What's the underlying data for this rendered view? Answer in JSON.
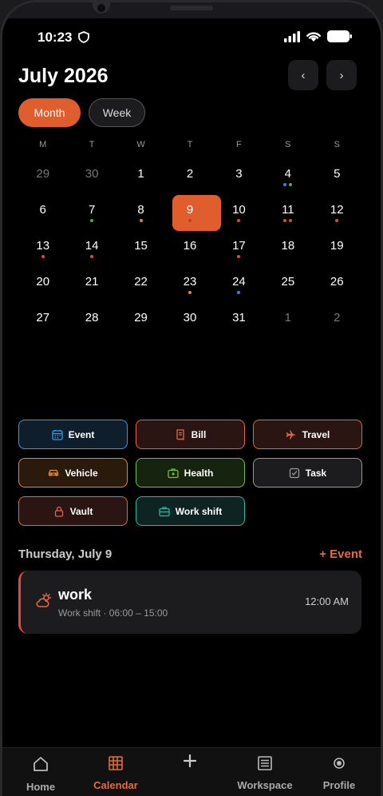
{
  "status": {
    "time": "10:23"
  },
  "header": {
    "title": "July 2026",
    "prev": "‹",
    "next": "›"
  },
  "view_toggle": {
    "month": "Month",
    "week": "Week"
  },
  "weekdays": [
    "M",
    "T",
    "W",
    "T",
    "F",
    "S",
    "S"
  ],
  "days": [
    {
      "n": "29",
      "other": true,
      "dots": []
    },
    {
      "n": "30",
      "other": true,
      "dots": []
    },
    {
      "n": "1",
      "dots": []
    },
    {
      "n": "2",
      "dots": []
    },
    {
      "n": "3",
      "dots": []
    },
    {
      "n": "4",
      "dots": [
        "#3b82e0",
        "#4caf50"
      ]
    },
    {
      "n": "5",
      "dots": []
    },
    {
      "n": "6",
      "dots": []
    },
    {
      "n": "7",
      "dots": [
        "#4caf50"
      ]
    },
    {
      "n": "8",
      "dots": [
        "#e08a2e"
      ]
    },
    {
      "n": "9",
      "selected": true,
      "dots": [
        "#b8431f"
      ]
    },
    {
      "n": "10",
      "dots": [
        "#e04848"
      ]
    },
    {
      "n": "11",
      "dots": [
        "#e04848",
        "#e04848"
      ]
    },
    {
      "n": "12",
      "dots": [
        "#e04848"
      ]
    },
    {
      "n": "13",
      "dots": [
        "#e04848"
      ]
    },
    {
      "n": "14",
      "dots": [
        "#e04848"
      ]
    },
    {
      "n": "15",
      "dots": []
    },
    {
      "n": "16",
      "dots": []
    },
    {
      "n": "17",
      "dots": [
        "#e04848"
      ]
    },
    {
      "n": "18",
      "dots": []
    },
    {
      "n": "19",
      "dots": []
    },
    {
      "n": "20",
      "dots": []
    },
    {
      "n": "21",
      "dots": []
    },
    {
      "n": "22",
      "dots": []
    },
    {
      "n": "23",
      "dots": [
        "#e08a2e"
      ]
    },
    {
      "n": "24",
      "dots": [
        "#3b82e0"
      ]
    },
    {
      "n": "25",
      "dots": []
    },
    {
      "n": "26",
      "dots": []
    },
    {
      "n": "27",
      "dots": []
    },
    {
      "n": "28",
      "dots": []
    },
    {
      "n": "29",
      "dots": []
    },
    {
      "n": "30",
      "dots": []
    },
    {
      "n": "31",
      "dots": []
    },
    {
      "n": "1",
      "other": true,
      "dots": []
    },
    {
      "n": "2",
      "other": true,
      "dots": []
    }
  ],
  "categories": [
    {
      "label": "Event",
      "icon": "calendar-icon",
      "color": "#3b9ae0",
      "bg": "#0f1e2c"
    },
    {
      "label": "Bill",
      "icon": "receipt-icon",
      "color": "#e0674a",
      "bg": "#2a1512"
    },
    {
      "label": "Travel",
      "icon": "plane-icon",
      "color": "#e0674a",
      "bg": "#2a1512"
    },
    {
      "label": "Vehicle",
      "icon": "car-icon",
      "color": "#e08a2e",
      "bg": "#2a1a0c"
    },
    {
      "label": "Health",
      "icon": "medkit-icon",
      "color": "#6fbf3a",
      "bg": "#16230e"
    },
    {
      "label": "Task",
      "icon": "checkbox-icon",
      "color": "#9a9a9a",
      "bg": "#1c1c1e"
    },
    {
      "label": "Vault",
      "icon": "lock-icon",
      "color": "#e0674a",
      "bg": "#2a1512"
    },
    {
      "label": "Work shift",
      "icon": "briefcase-icon",
      "color": "#2ab5a5",
      "bg": "#0d2422"
    }
  ],
  "selected_day": {
    "label": "Thursday, July 9",
    "add": "+ Event"
  },
  "event": {
    "title": "work",
    "subtitle": "Work shift · 06:00 – 15:00",
    "time": "12:00 AM",
    "icon": "cloud-sun-icon",
    "accent": "#e04848"
  },
  "tabs": [
    {
      "label": "Home",
      "icon": "home-icon",
      "active": false
    },
    {
      "label": "Calendar",
      "icon": "calendar-grid-icon",
      "active": true
    },
    {
      "label": "",
      "icon": "plus-icon",
      "active": false
    },
    {
      "label": "Workspace",
      "icon": "list-icon",
      "active": false
    },
    {
      "label": "Profile",
      "icon": "profile-icon",
      "active": false
    }
  ],
  "colors": {
    "accent": "#e05d2e",
    "background": "#000000"
  }
}
